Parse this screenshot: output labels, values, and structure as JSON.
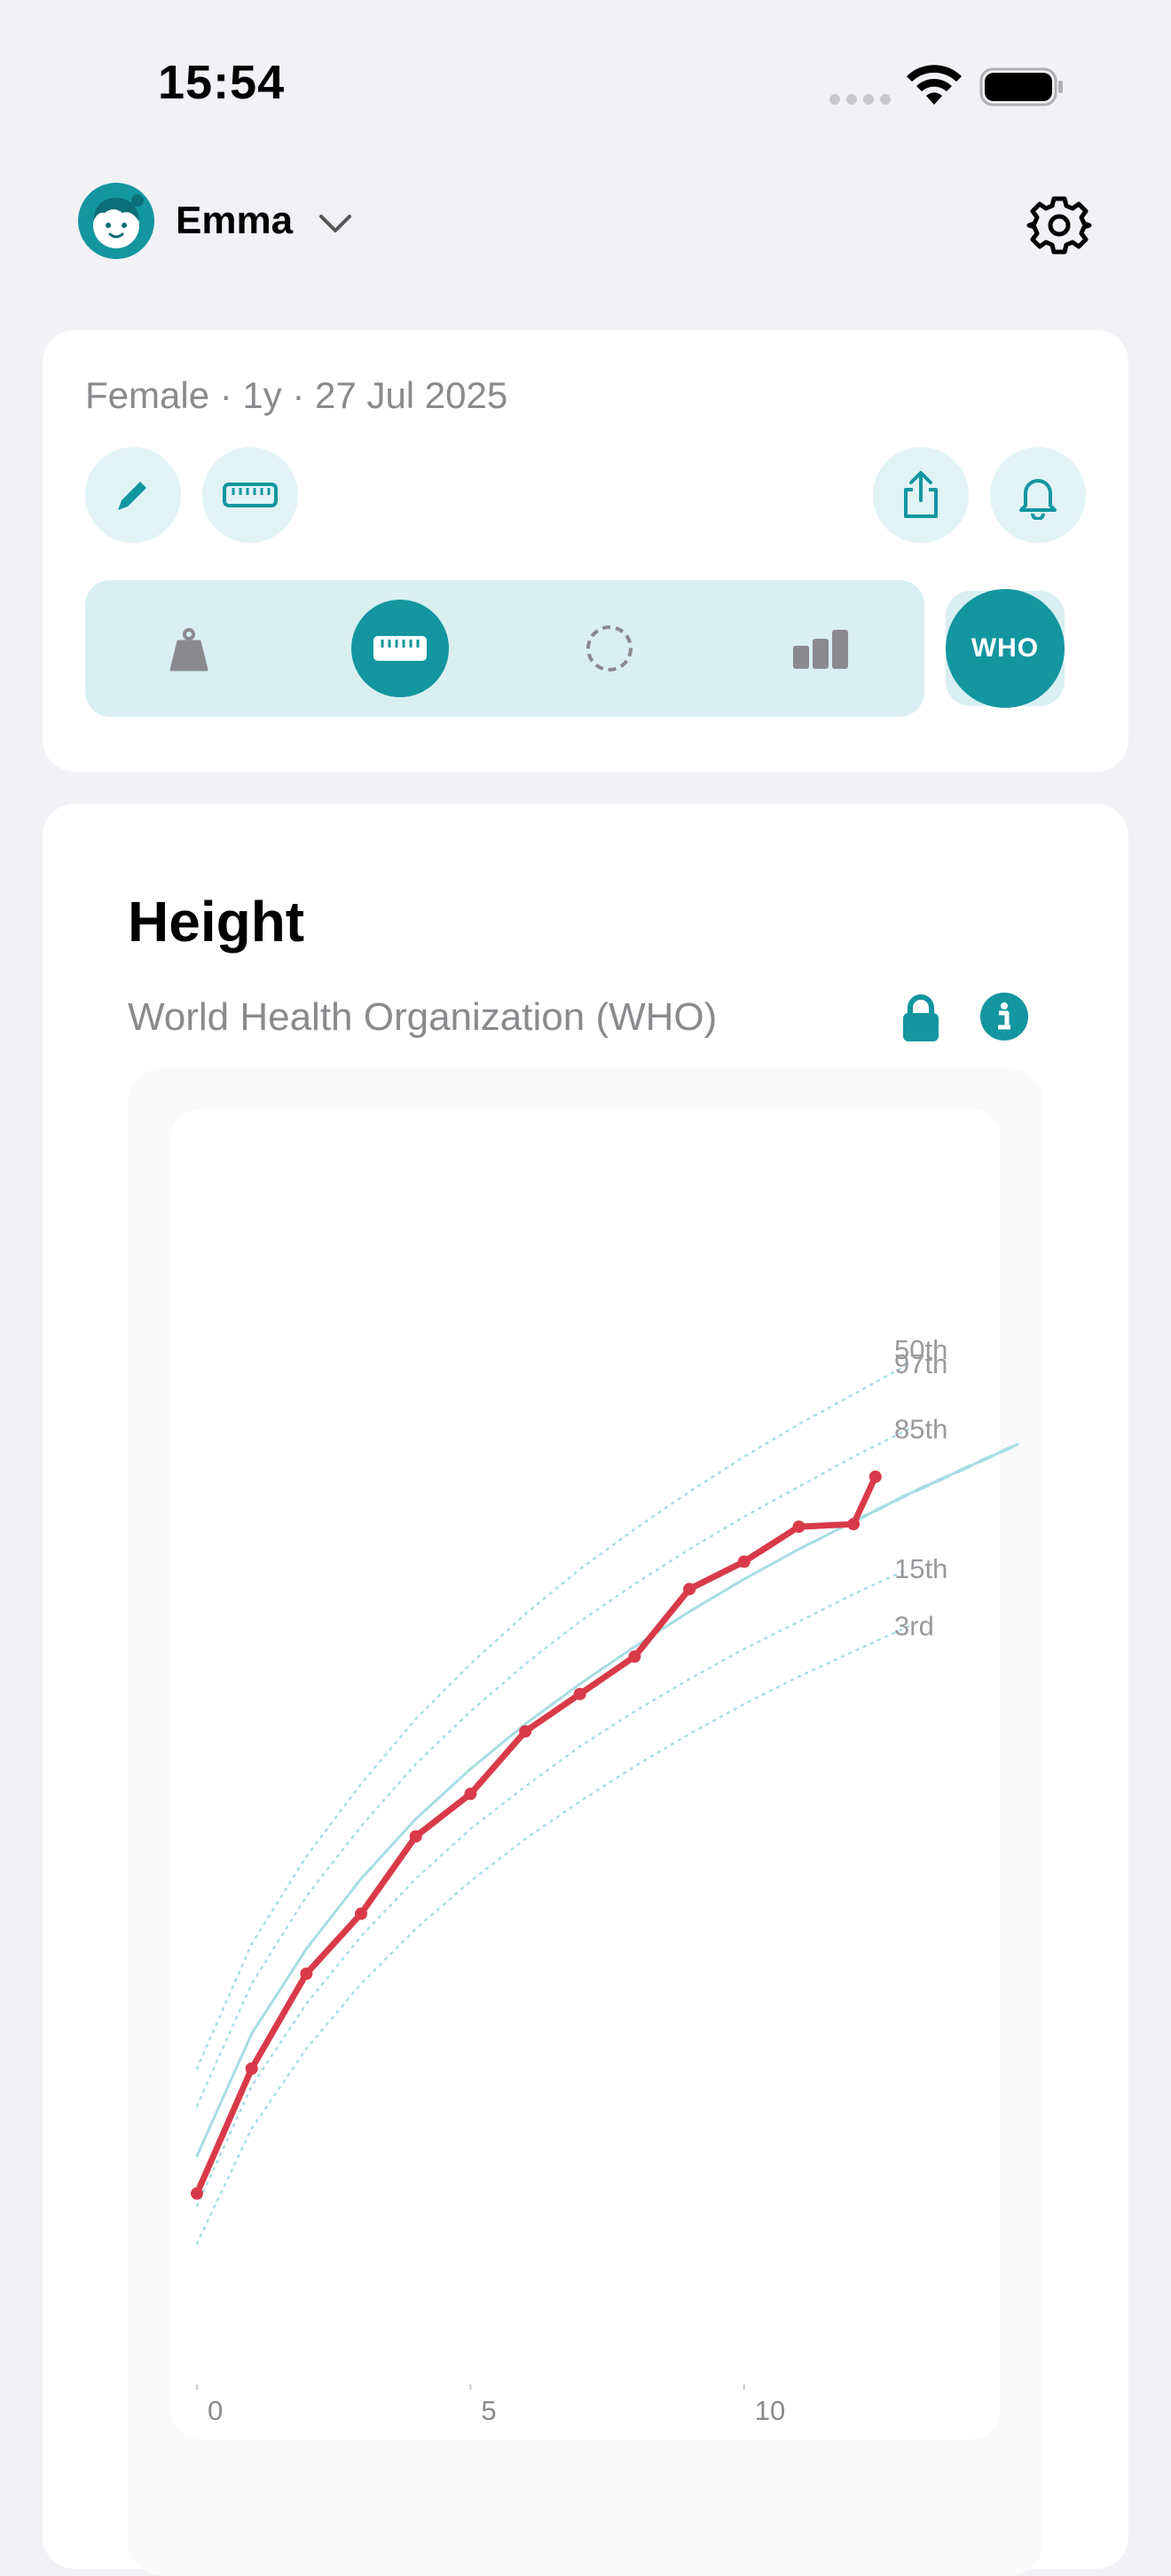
{
  "status_bar": {
    "time": "15:54"
  },
  "header": {
    "profile_name": "Emma"
  },
  "summary": {
    "meta": "Female · 1y · 27 Jul 2025",
    "who_label": "WHO",
    "active_metric": "height"
  },
  "chart_panel": {
    "title": "Height",
    "subtitle": "World Health Organization (WHO)"
  },
  "colors": {
    "accent": "#1396a0",
    "accent_light": "#e1f3f5",
    "measurement": "#d93a4a",
    "percentile": "#a6dde3"
  },
  "chart_data": {
    "type": "line",
    "title": "Height",
    "subtitle": "World Health Organization (WHO)",
    "xlabel": "",
    "ylabel": "",
    "x_ticks": [
      0,
      5,
      10
    ],
    "xlim": [
      0,
      15.5
    ],
    "ylim": [
      40,
      92
    ],
    "grid": false,
    "percentile_labels": [
      "97th",
      "85th",
      "50th",
      "15th",
      "3rd"
    ],
    "percentiles": [
      {
        "name": "97th",
        "x": [
          0,
          1,
          2,
          3,
          4,
          5,
          6,
          7,
          8,
          9,
          10,
          11,
          12,
          13
        ],
        "values": [
          53.0,
          58.0,
          61.5,
          64.4,
          67.0,
          69.2,
          71.2,
          73.0,
          74.6,
          76.1,
          77.5,
          78.8,
          80.0,
          81.2
        ]
      },
      {
        "name": "85th",
        "x": [
          0,
          1,
          2,
          3,
          4,
          5,
          6,
          7,
          8,
          9,
          10,
          11,
          12,
          13
        ],
        "values": [
          51.5,
          56.4,
          59.9,
          62.7,
          65.2,
          67.3,
          69.2,
          70.9,
          72.4,
          73.8,
          75.1,
          76.3,
          77.5,
          78.6
        ]
      },
      {
        "name": "50th",
        "x": [
          0,
          1,
          2,
          3,
          4,
          5,
          6,
          7,
          8,
          9,
          10,
          11,
          12,
          13,
          14,
          15
        ],
        "values": [
          49.5,
          54.4,
          57.8,
          60.6,
          63.0,
          65.0,
          66.8,
          68.4,
          69.9,
          71.3,
          72.6,
          73.8,
          74.9,
          76.0,
          77.0,
          78.0
        ]
      },
      {
        "name": "15th",
        "x": [
          0,
          1,
          2,
          3,
          4,
          5,
          6,
          7,
          8,
          9,
          10,
          11,
          12,
          13
        ],
        "values": [
          47.5,
          52.3,
          55.6,
          58.3,
          60.6,
          62.6,
          64.3,
          65.9,
          67.3,
          68.6,
          69.8,
          70.9,
          72.0,
          73.0
        ]
      },
      {
        "name": "3rd",
        "x": [
          0,
          1,
          2,
          3,
          4,
          5,
          6,
          7,
          8,
          9,
          10,
          11,
          12,
          13
        ],
        "values": [
          46.0,
          50.6,
          53.8,
          56.4,
          58.6,
          60.5,
          62.2,
          63.7,
          65.1,
          66.4,
          67.6,
          68.7,
          69.7,
          70.7
        ]
      }
    ],
    "series": [
      {
        "name": "",
        "x": [
          0,
          1,
          2,
          3,
          4,
          5,
          6,
          7,
          8,
          9,
          10,
          11,
          12,
          12.4
        ],
        "values": [
          48.0,
          53.0,
          56.8,
          59.2,
          62.3,
          64.0,
          66.5,
          68.0,
          69.5,
          72.2,
          73.3,
          74.7,
          74.8,
          76.7
        ]
      }
    ]
  }
}
